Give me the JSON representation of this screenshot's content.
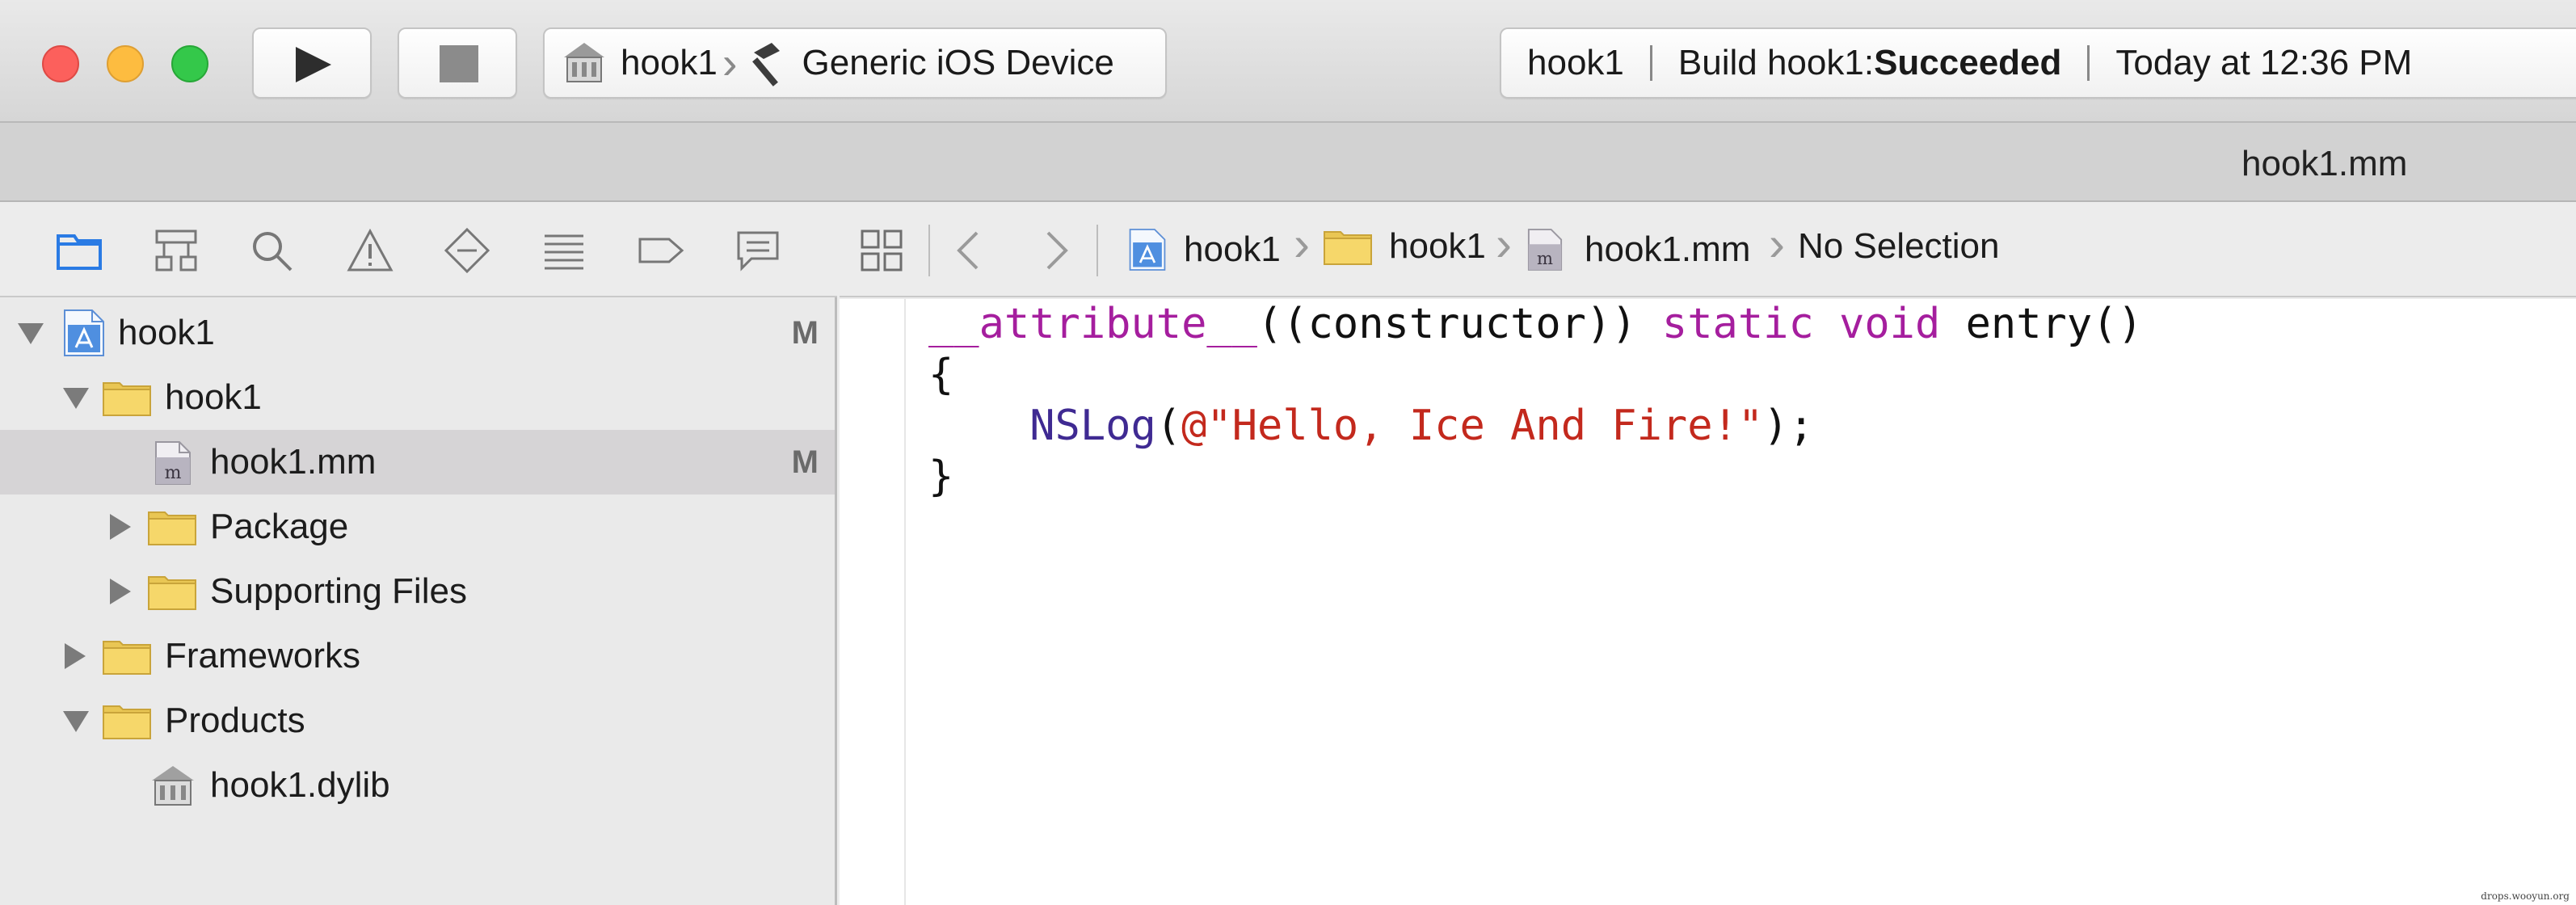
{
  "toolbar": {
    "scheme_project": "hook1",
    "scheme_device": "Generic iOS Device",
    "activity_project": "hook1",
    "activity_status_prefix": "Build hook1: ",
    "activity_status_result": "Succeeded",
    "activity_time": "Today at 12:36 PM"
  },
  "tabbar": {
    "title": "hook1.mm"
  },
  "navigator": {
    "icons": [
      "folder-icon",
      "hierarchy-icon",
      "search-icon",
      "warning-icon",
      "breakpoint-icon",
      "list-icon",
      "tag-icon",
      "comment-icon"
    ],
    "tree": [
      {
        "label": "hook1",
        "status": "M"
      },
      {
        "label": "hook1"
      },
      {
        "label": "hook1.mm",
        "status": "M"
      },
      {
        "label": "Package"
      },
      {
        "label": "Supporting Files"
      },
      {
        "label": "Frameworks"
      },
      {
        "label": "Products"
      },
      {
        "label": "hook1.dylib"
      }
    ]
  },
  "jumpbar": {
    "crumbs": [
      "hook1",
      "hook1",
      "hook1.mm",
      "No Selection"
    ]
  },
  "editor": {
    "lines": [
      [
        "__attribute__",
        "((constructor)) ",
        "static",
        " ",
        "void",
        " entry()"
      ],
      [
        "{"
      ],
      [
        "    ",
        "NSLog",
        "(",
        "@\"Hello, Ice And Fire!\"",
        ");"
      ],
      [
        "}"
      ]
    ]
  },
  "watermark": "drops.wooyun.org",
  "colors": {
    "keyword": "#a51e9e",
    "function": "#3f2a92",
    "string": "#c3291d"
  }
}
